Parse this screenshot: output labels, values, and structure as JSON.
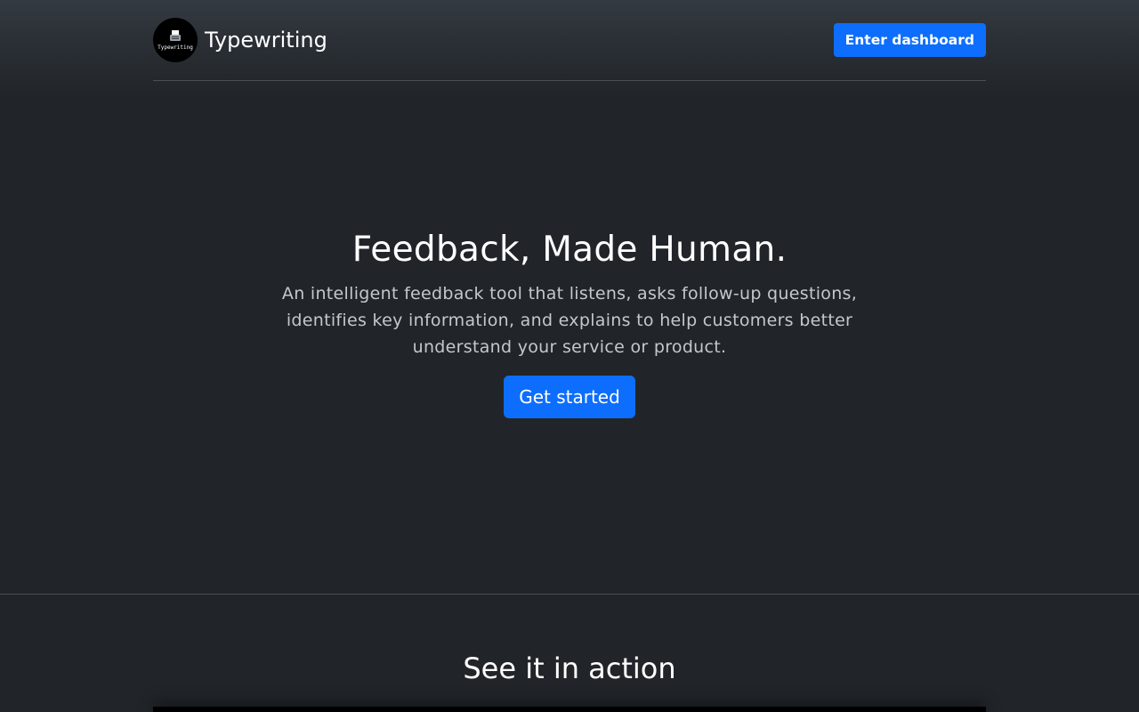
{
  "header": {
    "logo_text": "Typewriting",
    "brand_name": "Typewriting",
    "dashboard_button": "Enter dashboard"
  },
  "hero": {
    "title": "Feedback, Made Human.",
    "description": "An intelligent feedback tool that listens, asks follow-up questions, identifies key information, and explains to help customers better understand your service or product.",
    "cta_label": "Get started"
  },
  "demo": {
    "title": "See it in action"
  },
  "colors": {
    "background": "#212529",
    "accent": "#0d6efd"
  },
  "icons": {
    "logo": "typewriter-icon"
  }
}
